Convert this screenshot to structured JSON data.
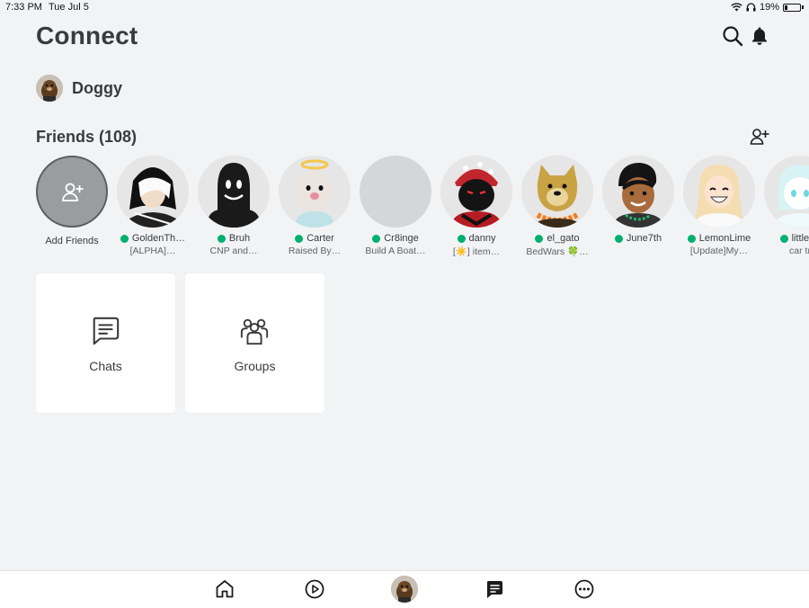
{
  "statusbar": {
    "time": "7:33 PM",
    "date": "Tue Jul 5",
    "battery": "19%"
  },
  "header": {
    "title": "Connect"
  },
  "icons": {
    "search": "search-icon",
    "notifications": "bell-icon",
    "add_friend": "add-friend-icon"
  },
  "profile": {
    "name": "Doggy"
  },
  "friends": {
    "header": "Friends (108)",
    "add_label": "Add Friends",
    "items": [
      {
        "name": "GoldenTh…",
        "status": "[ALPHA]…",
        "online": true
      },
      {
        "name": "Bruh",
        "status": "CNP and…",
        "online": true
      },
      {
        "name": "Carter",
        "status": "Raised By…",
        "online": true
      },
      {
        "name": "Cr8inge",
        "status": "Build A Boat…",
        "online": true
      },
      {
        "name": "danny",
        "status": "[☀️] item…",
        "online": true
      },
      {
        "name": "el_gato",
        "status": "BedWars 🍀…",
        "online": true
      },
      {
        "name": "June7th",
        "status": "",
        "online": true
      },
      {
        "name": "LemonLime",
        "status": "[Update]My…",
        "online": true
      },
      {
        "name": "little_u",
        "status": "car tr",
        "online": true
      }
    ]
  },
  "tiles": {
    "chats": "Chats",
    "groups": "Groups"
  },
  "bottom_nav": [
    "home-icon",
    "play-icon",
    "avatar",
    "chat-icon",
    "more-icon"
  ],
  "colors": {
    "online": "#00b06f",
    "background": "#f2f3f5",
    "text": "#393b3d"
  }
}
